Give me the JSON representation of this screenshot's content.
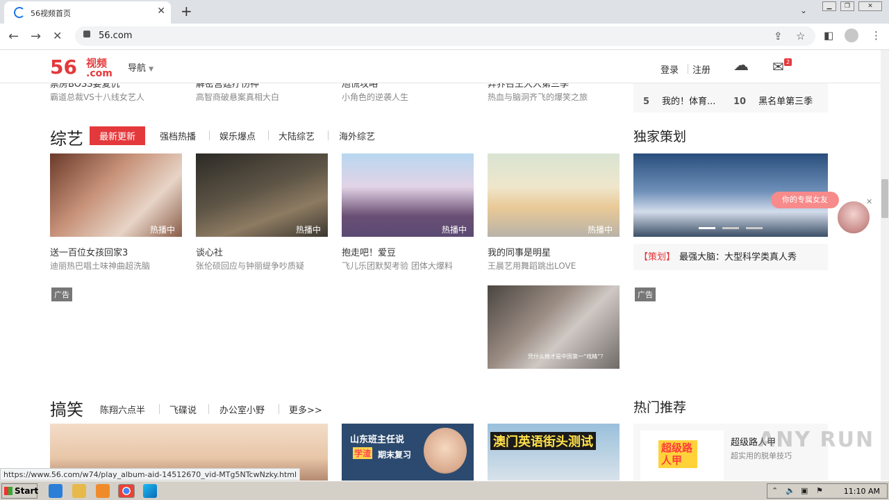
{
  "browser": {
    "tab_title": "56视频首页",
    "url": "56.com",
    "status_url": "https://www.56.com/w74/play_album-aid-14512670_vid-MTg5NTcwNzky.html"
  },
  "site": {
    "logo_main": "56",
    "logo_sub": "视频",
    "logo_dotcom": ".com",
    "nav_label": "导航",
    "login": "登录",
    "register": "注册",
    "mail_count": "2"
  },
  "top_strip": {
    "items": [
      {
        "title": "票房BOSS要复仇",
        "sub": "霸道总裁VS十八线女艺人"
      },
      {
        "title": "解密宫廷疗伤神",
        "sub": "高智商破悬案真相大白"
      },
      {
        "title": "旭慌攻略",
        "sub": "小角色的逆袭人生"
      },
      {
        "title": "异界召王大人第三季",
        "sub": "热血与脑洞齐飞的爆笑之旅"
      }
    ],
    "rank": [
      {
        "num": "5",
        "title": "我的！体育..."
      },
      {
        "num": "10",
        "title": "黑名单第三季"
      }
    ]
  },
  "variety": {
    "title": "综艺",
    "tabs": [
      "最新更新",
      "强档热播",
      "娱乐爆点",
      "大陆综艺",
      "海外综艺"
    ],
    "badge": "热播中",
    "cards": [
      {
        "title": "送一百位女孩回家3",
        "sub": "迪丽热巴唱土味神曲超洗脑"
      },
      {
        "title": "谈心社",
        "sub": "张伦硕回应与钟丽缇争吵质疑"
      },
      {
        "title": "抱走吧！爱豆",
        "sub": "飞儿乐团默契考验 团体大爆料"
      },
      {
        "title": "我的同事是明星",
        "sub": "王晨艺用舞蹈跳出LOVE"
      }
    ],
    "ad_label": "广告",
    "ad_caption": "凭什么她才是中国第一“戏精”？"
  },
  "exclusive": {
    "title": "独家策划",
    "tag": "【策划】",
    "headline": "最强大脑：大型科学类真人秀",
    "ad_label": "广告",
    "float_label": "你的专属女友"
  },
  "comedy": {
    "title": "搞笑",
    "tabs": [
      "陈翔六点半",
      "飞碟说",
      "办公室小野",
      "更多>>"
    ],
    "card2_text_a": "山东班主任说",
    "card2_text_b": "学渣",
    "card2_text_c": "期末复习",
    "card3_text": "澳门英语街头测试"
  },
  "hot": {
    "title": "热门推荐",
    "item_title": "超级路人甲",
    "item_sub": "超实用的脱单技巧",
    "item_logo": "超级路人甲",
    "watermark": "ANY RUN"
  },
  "taskbar": {
    "start": "Start",
    "clock": "11:10 AM"
  }
}
